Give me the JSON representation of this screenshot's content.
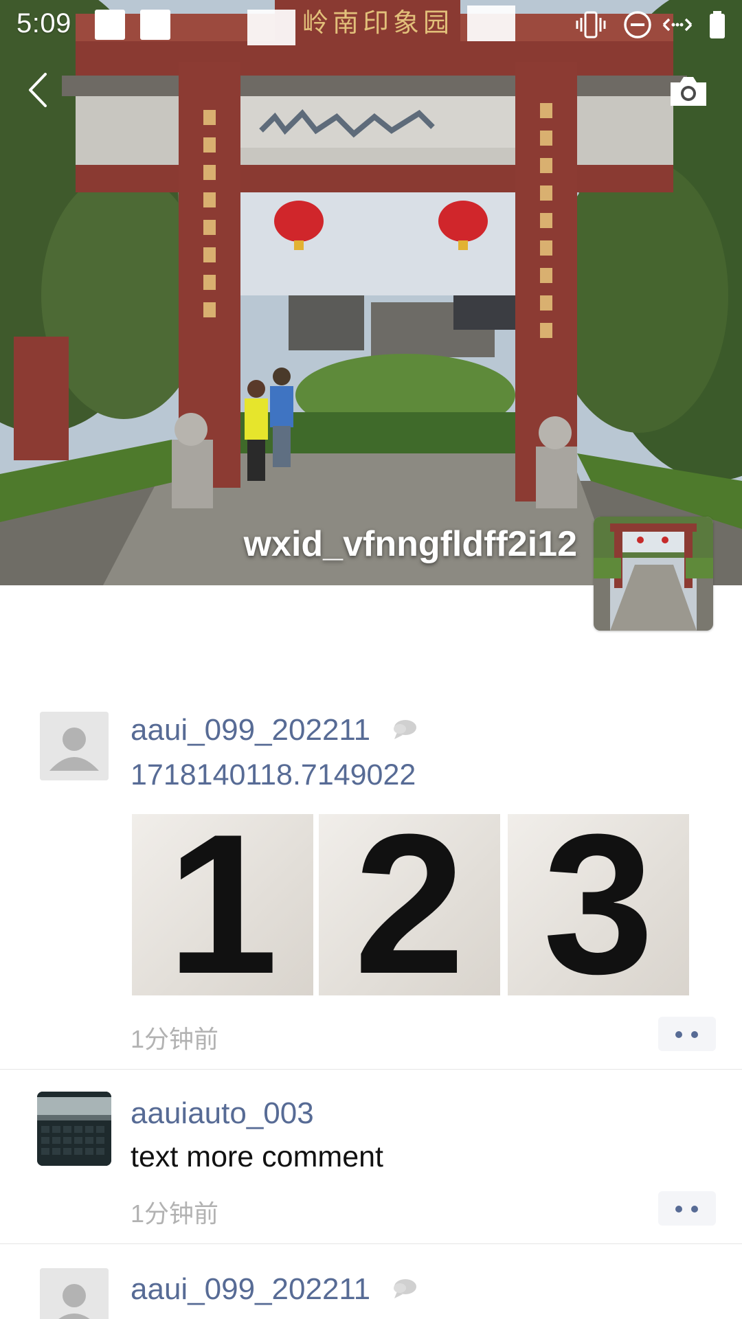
{
  "status_bar": {
    "time": "5:09"
  },
  "header": {
    "back_icon": "chevron-left-icon",
    "camera_icon": "camera-icon",
    "cover_sign_text": "岭南印象园",
    "profile_name": "wxid_vfnngfldff2i12"
  },
  "feed": {
    "posts": [
      {
        "username": "aaui_099_202211",
        "text": "1718140118.7149022",
        "images": [
          "1",
          "2",
          "3"
        ],
        "time": "1分钟前"
      },
      {
        "username": "aauiauto_003",
        "text": "text more comment",
        "time": "1分钟前"
      },
      {
        "username": "aaui_099_202211"
      }
    ]
  },
  "colors": {
    "link_blue": "#576b95",
    "muted_gray": "#b2b2b2",
    "divider": "#e5e5e5"
  }
}
